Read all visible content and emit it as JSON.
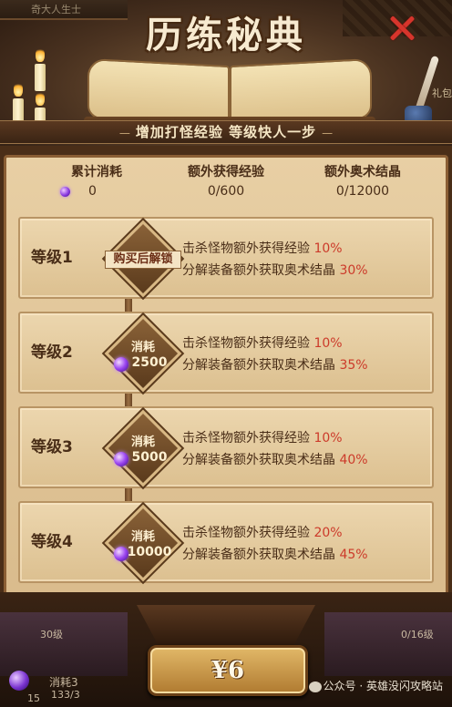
{
  "header": {
    "title": "历练秘典",
    "subtitle": "增加打怪经验 等级快人一步",
    "bg_left_text": "奇大人生士",
    "bg_right_text": "礼包"
  },
  "stats": {
    "total_cost_label": "累计消耗",
    "total_cost_value": "0",
    "extra_exp_label": "额外获得经验",
    "extra_exp_value": "0/600",
    "extra_crystal_label": "额外奥术结晶",
    "extra_crystal_value": "0/12000"
  },
  "levels": [
    {
      "name": "等级1",
      "locked_label": "购买后解锁",
      "bonus1_text": "击杀怪物额外获得经验",
      "bonus1_pct": "10%",
      "bonus2_text": "分解装备额外获取奥术结晶",
      "bonus2_pct": "30%"
    },
    {
      "name": "等级2",
      "cost_label": "消耗",
      "cost_value": "2500",
      "bonus1_text": "击杀怪物额外获得经验",
      "bonus1_pct": "10%",
      "bonus2_text": "分解装备额外获取奥术结晶",
      "bonus2_pct": "35%"
    },
    {
      "name": "等级3",
      "cost_label": "消耗",
      "cost_value": "5000",
      "bonus1_text": "击杀怪物额外获得经验",
      "bonus1_pct": "10%",
      "bonus2_text": "分解装备额外获取奥术结晶",
      "bonus2_pct": "40%"
    },
    {
      "name": "等级4",
      "cost_label": "消耗",
      "cost_value": "10000",
      "bonus1_text": "击杀怪物额外获得经验",
      "bonus1_pct": "20%",
      "bonus2_text": "分解装备额外获取奥术结晶",
      "bonus2_pct": "45%"
    }
  ],
  "purchase": {
    "price_label": "¥6"
  },
  "background_bottom": {
    "left_level": "30级",
    "left_cost": "消耗3",
    "left_num": "15",
    "left_frac": "133/3",
    "right_level": "0/16级"
  },
  "watermark": {
    "text": "公众号 · 英雄没闪攻略站"
  },
  "colors": {
    "percent": "#cc3a2a",
    "parchment": "#e8cfa4",
    "text_brown": "#4a2e18",
    "crystal": "#9a44f0",
    "close": "#d6352c"
  }
}
